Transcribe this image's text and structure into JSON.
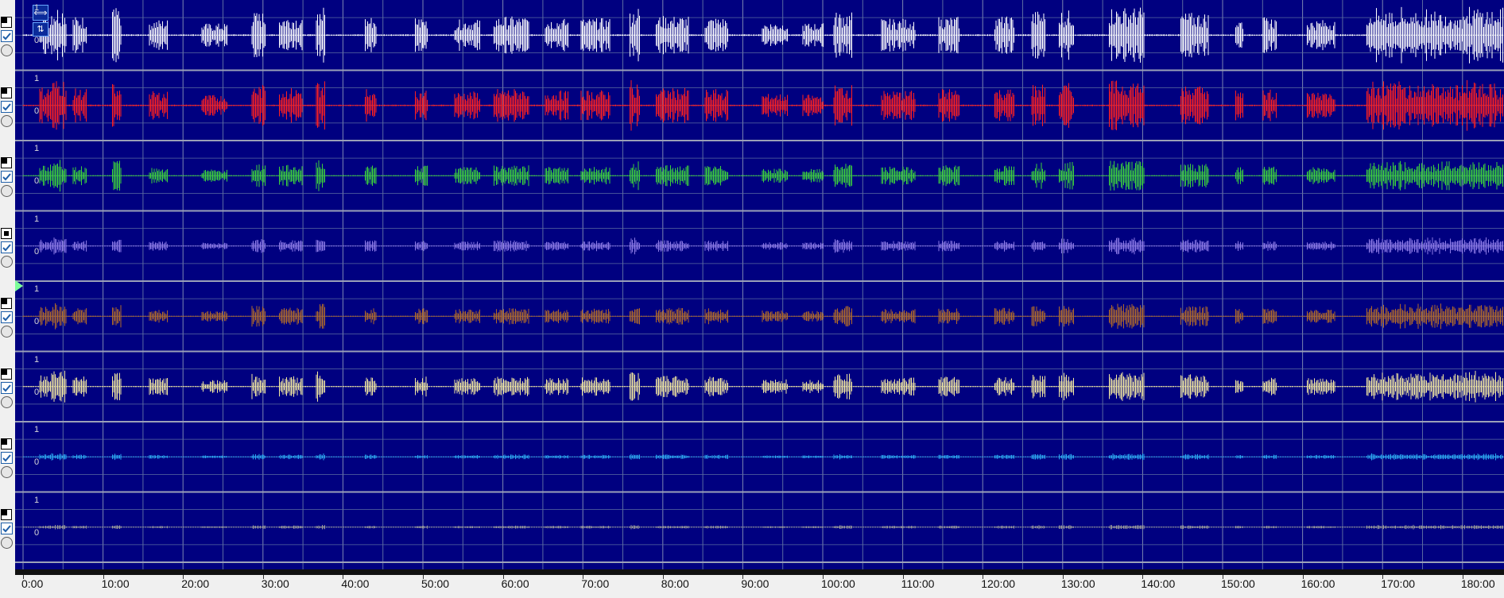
{
  "channels": [
    {
      "color": "#ffffff",
      "scale_max": "1",
      "scale_zero": "0",
      "mode": "unselected"
    },
    {
      "color": "#ff2020",
      "scale_max": "1",
      "scale_zero": "0",
      "mode": "unselected"
    },
    {
      "color": "#3cd23c",
      "scale_max": "1",
      "scale_zero": "0",
      "mode": "unselected"
    },
    {
      "color": "#8c7ae6",
      "scale_max": "1",
      "scale_zero": "0",
      "mode": "selected"
    },
    {
      "color": "#b06a2a",
      "scale_max": "1",
      "scale_zero": "0",
      "mode": "unselected"
    },
    {
      "color": "#f2e7a0",
      "scale_max": "1",
      "scale_zero": "0",
      "mode": "unselected"
    },
    {
      "color": "#2aa7f0",
      "scale_max": "1",
      "scale_zero": "0",
      "mode": "unselected"
    },
    {
      "color": "#9a9a9a",
      "scale_max": "1",
      "scale_zero": "0",
      "mode": "unselected"
    }
  ],
  "time_axis": {
    "labels": [
      "0:00",
      "10:00",
      "20:00",
      "30:00",
      "40:00",
      "50:00",
      "60:00",
      "70:00",
      "80:00",
      "90:00",
      "100:00",
      "110:00",
      "120:00",
      "130:00",
      "140:00",
      "150:00",
      "160:00",
      "170:00",
      "180:00"
    ],
    "max_minutes": 183
  },
  "colors": {
    "plot_background": "#000080",
    "grid_minor": "#5a6aa0",
    "grid_major": "#7b86b0",
    "separator": "#111111",
    "icon_accent": "#1f5fa8"
  },
  "toolbar": {
    "zoom_icon_1": "⟺",
    "zoom_icon_2": "⇅"
  },
  "icons": {
    "mode": "view-mode-icon",
    "checkbox": "checkbox-checked-icon",
    "radio": "radio-icon",
    "marker": "play-marker-icon",
    "zoom": "zoom-fit-icon"
  }
}
